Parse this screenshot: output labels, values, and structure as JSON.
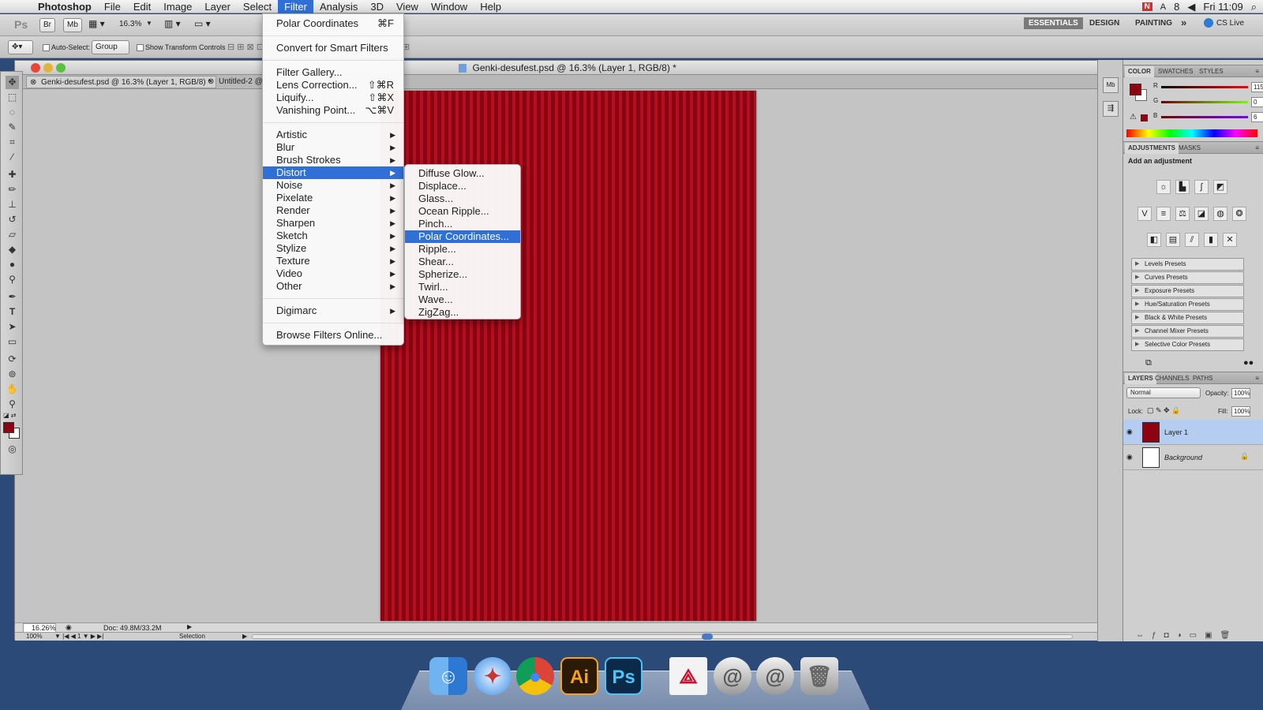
{
  "menubar": {
    "apple": "",
    "app": "Photoshop",
    "items": [
      "File",
      "Edit",
      "Image",
      "Layer",
      "Select",
      "Filter",
      "Analysis",
      "3D",
      "View",
      "Window",
      "Help"
    ],
    "active": "Filter",
    "right": {
      "battery": "8",
      "time": "Fri 11:09"
    }
  },
  "appbar": {
    "ps": "Ps",
    "br": "Br",
    "mb": "Mb",
    "zoom": "16.3%",
    "workspaces": [
      "ESSENTIALS",
      "DESIGN",
      "PAINTING"
    ],
    "more": "»",
    "cslive": "CS Live"
  },
  "options": {
    "auto_select": "Auto-Select:",
    "group": "Group",
    "show_transform": "Show Transform Controls"
  },
  "document": {
    "title": "Genki-desufest.psd @ 16.3% (Layer 1, RGB/8) *",
    "tab1": "Genki-desufest.psd @ 16.3% (Layer 1, RGB/8) *",
    "tab2": "Untitled-2 @",
    "status_zoom": "16.26%",
    "status_doc": "Doc: 49.8M/33.2M",
    "status2_zoom": "100%",
    "status2_mode": "Selection"
  },
  "filter_menu": {
    "last_filter": "Polar Coordinates",
    "last_filter_sc": "⌘F",
    "convert": "Convert for Smart Filters",
    "gallery": "Filter Gallery...",
    "lens": "Lens Correction...",
    "lens_sc": "⇧⌘R",
    "liquify": "Liquify...",
    "liquify_sc": "⇧⌘X",
    "vanish": "Vanishing Point...",
    "vanish_sc": "⌥⌘V",
    "groups": [
      "Artistic",
      "Blur",
      "Brush Strokes",
      "Distort",
      "Noise",
      "Pixelate",
      "Render",
      "Sharpen",
      "Sketch",
      "Stylize",
      "Texture",
      "Video",
      "Other"
    ],
    "digimarc": "Digimarc",
    "browse": "Browse Filters Online..."
  },
  "distort_menu": {
    "items": [
      "Diffuse Glow...",
      "Displace...",
      "Glass...",
      "Ocean Ripple...",
      "Pinch...",
      "Polar Coordinates...",
      "Ripple...",
      "Shear...",
      "Spherize...",
      "Twirl...",
      "Wave...",
      "ZigZag..."
    ],
    "selected": "Polar Coordinates..."
  },
  "color_panel": {
    "tabs": [
      "COLOR",
      "SWATCHES",
      "STYLES"
    ],
    "r_label": "R",
    "g_label": "G",
    "b_label": "B",
    "r": "115",
    "g": "0",
    "b": "6",
    "fg_color": "#730006"
  },
  "adjustments_panel": {
    "tabs": [
      "ADJUSTMENTS",
      "MASKS"
    ],
    "heading": "Add an adjustment",
    "presets": [
      "Levels Presets",
      "Curves Presets",
      "Exposure Presets",
      "Hue/Saturation Presets",
      "Black & White Presets",
      "Channel Mixer Presets",
      "Selective Color Presets"
    ]
  },
  "layers_panel": {
    "tabs": [
      "LAYERS",
      "CHANNELS",
      "PATHS"
    ],
    "blend": "Normal",
    "opacity_label": "Opacity:",
    "opacity": "100%",
    "lock_label": "Lock:",
    "fill_label": "Fill:",
    "fill": "100%",
    "layers": [
      "Layer 1",
      "Background"
    ]
  },
  "dock": {
    "apps": [
      "Finder",
      "Safari",
      "Chrome",
      "Ai",
      "Ps",
      "Acrobat",
      "Mail",
      "Mail",
      "Trash"
    ]
  },
  "colors": {
    "accent": "#2f6fd6",
    "canvas_red": "#8c0412"
  }
}
